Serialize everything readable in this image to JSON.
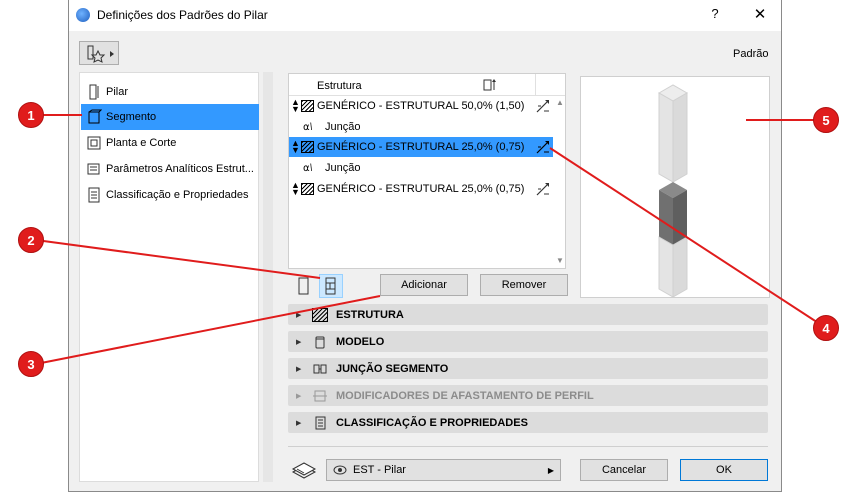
{
  "window": {
    "title": "Definições dos Padrões do Pilar",
    "help": "?",
    "close": "✕",
    "mode_label": "Padrão"
  },
  "nav": {
    "items": [
      {
        "label": "Pilar",
        "selected": false
      },
      {
        "label": "Segmento",
        "selected": true
      },
      {
        "label": "Planta e Corte",
        "selected": false
      },
      {
        "label": "Parâmetros Analíticos Estrut...",
        "selected": false
      },
      {
        "label": "Classificação e Propriedades",
        "selected": false
      }
    ]
  },
  "structure": {
    "column_header": "Estrutura",
    "rows": [
      {
        "type": "segment",
        "label": "GENÉRICO - ESTRUTURAL 50,0% (1,50)",
        "selected": false
      },
      {
        "type": "junction",
        "label": "Junção"
      },
      {
        "type": "segment",
        "label": "GENÉRICO - ESTRUTURAL 25,0% (0,75)",
        "selected": true
      },
      {
        "type": "junction",
        "label": "Junção"
      },
      {
        "type": "segment",
        "label": "GENÉRICO - ESTRUTURAL 25,0% (0,75)",
        "selected": false
      }
    ]
  },
  "buttons": {
    "add": "Adicionar",
    "remove": "Remover",
    "cancel": "Cancelar",
    "ok": "OK"
  },
  "sections": [
    {
      "title": "ESTRUTURA",
      "disabled": false,
      "icon": "hatch-icon"
    },
    {
      "title": "MODELO",
      "disabled": false,
      "icon": "cylinder-icon"
    },
    {
      "title": "JUNÇÃO SEGMENTO",
      "disabled": false,
      "icon": "junction-icon"
    },
    {
      "title": "MODIFICADORES DE AFASTAMENTO DE PERFIL",
      "disabled": true,
      "icon": "profile-offset-icon"
    },
    {
      "title": "CLASSIFICAÇÃO E PROPRIEDADES",
      "disabled": false,
      "icon": "document-icon"
    }
  ],
  "layer": {
    "value": "EST - Pilar"
  },
  "callouts": [
    "1",
    "2",
    "3",
    "4",
    "5"
  ],
  "colors": {
    "selection": "#3399ff",
    "callout": "#e01c1c"
  }
}
